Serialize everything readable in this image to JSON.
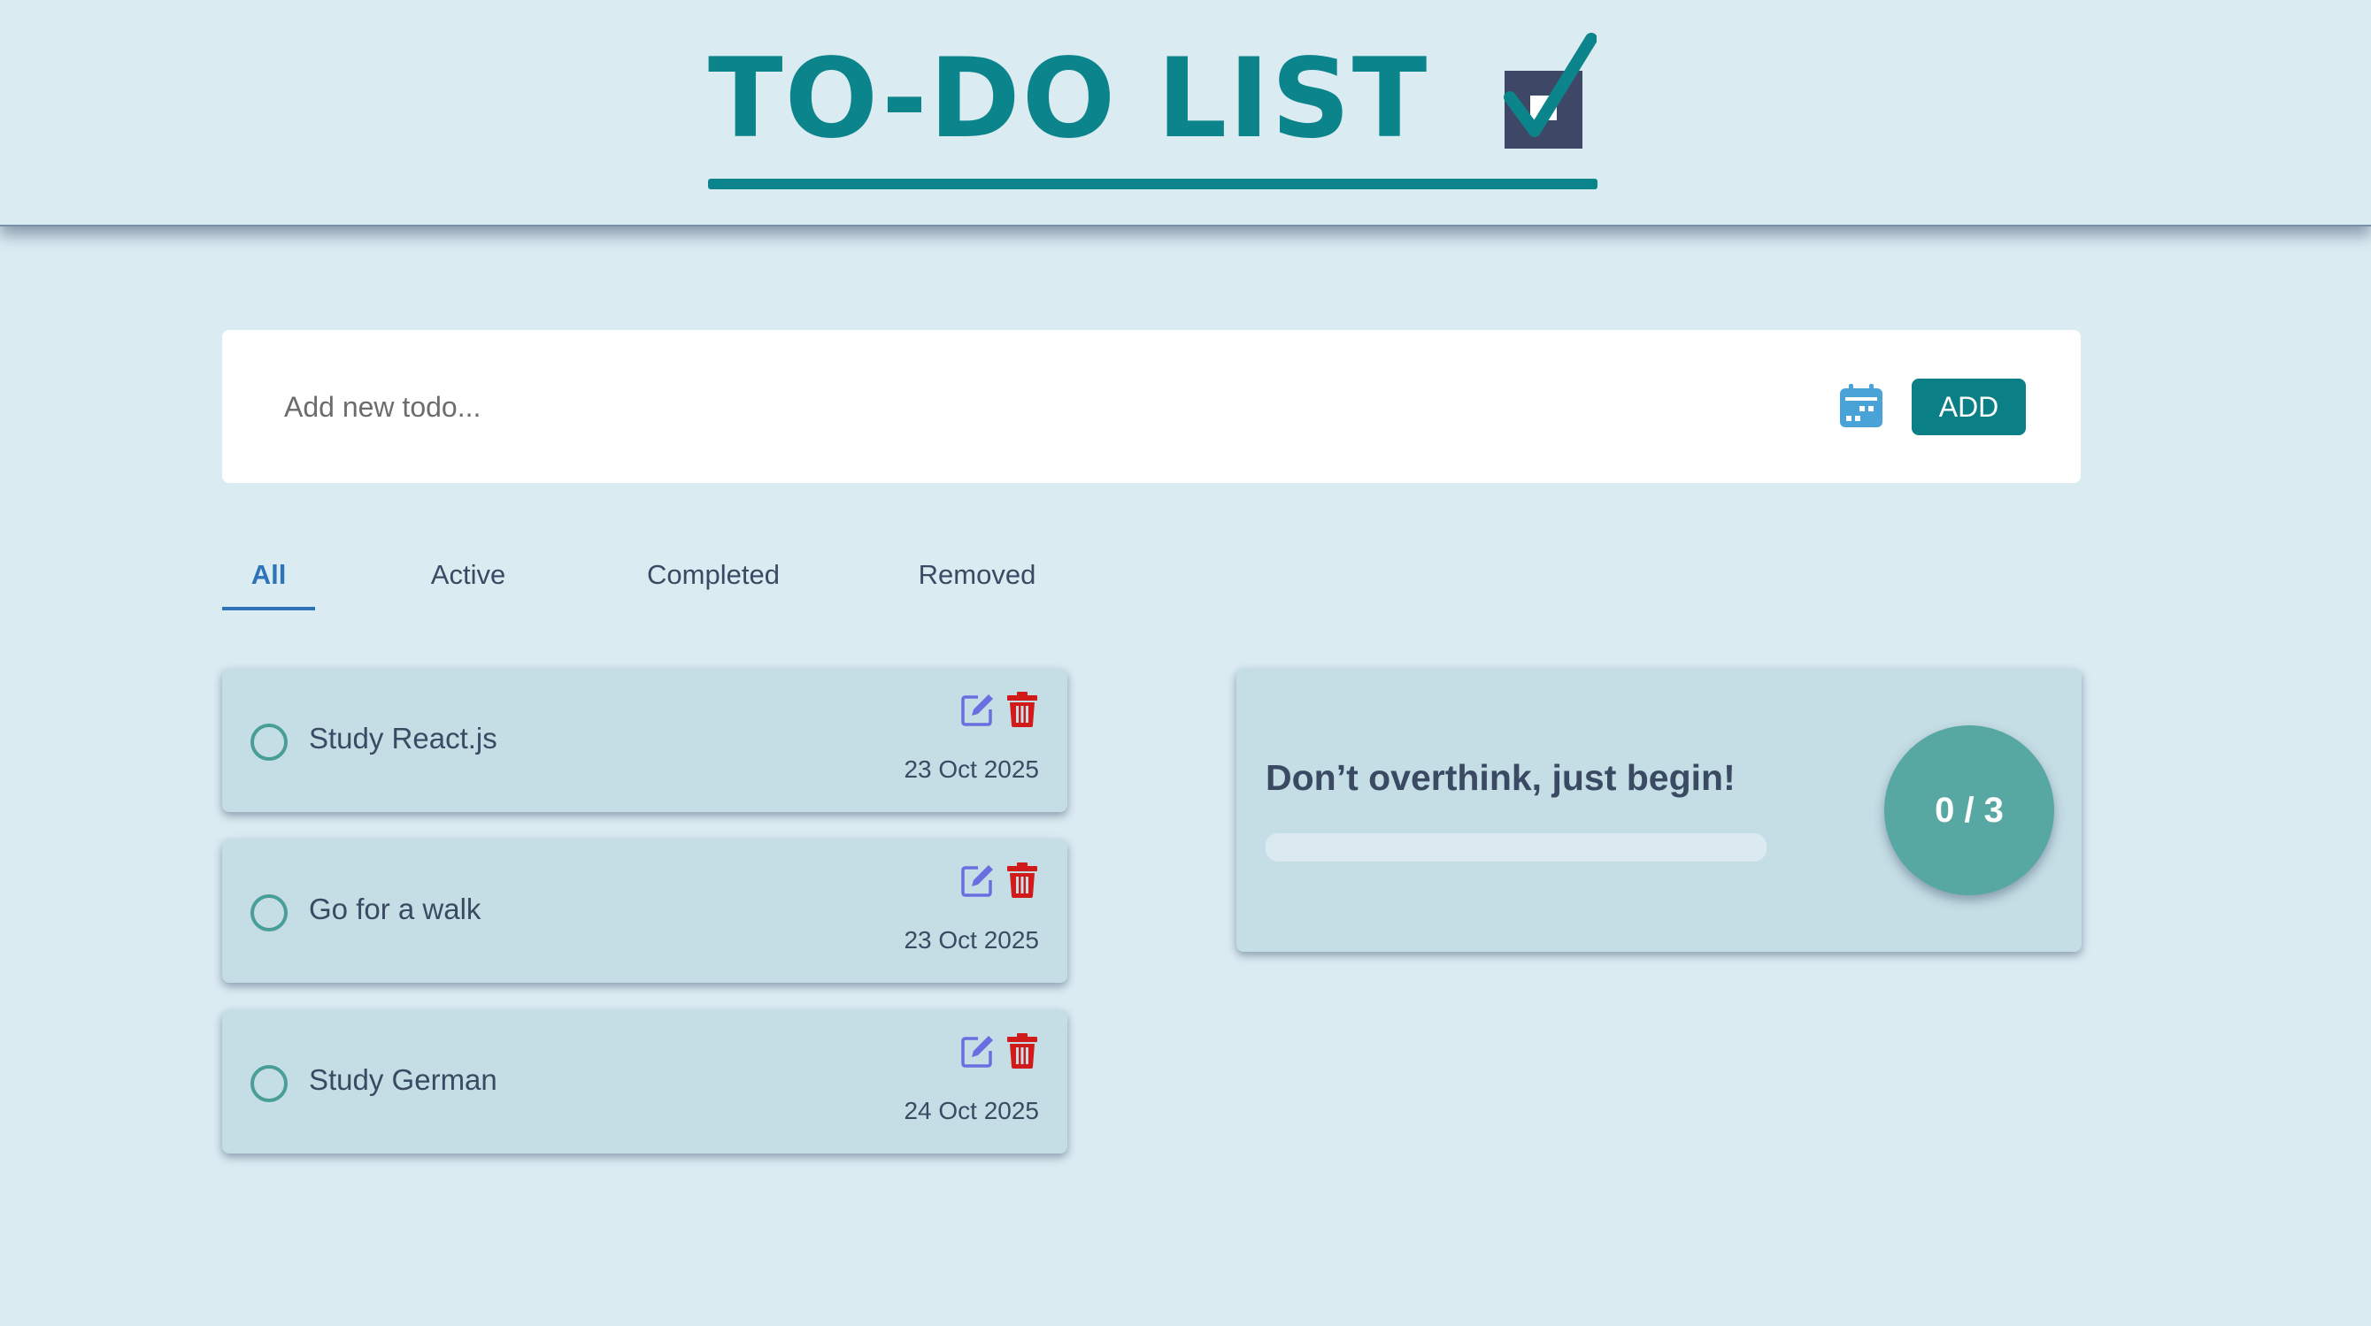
{
  "header": {
    "logo_text": "TO-DO LIST",
    "logo_icon": "checkbox-check-icon"
  },
  "add_form": {
    "placeholder": "Add new todo...",
    "value": "",
    "calendar_icon": "calendar-icon",
    "add_label": "ADD"
  },
  "tabs": [
    {
      "label": "All",
      "active": true
    },
    {
      "label": "Active",
      "active": false
    },
    {
      "label": "Completed",
      "active": false
    },
    {
      "label": "Removed",
      "active": false
    }
  ],
  "todos": [
    {
      "title": "Study React.js",
      "date": "23 Oct 2025",
      "completed": false
    },
    {
      "title": "Go for a walk",
      "date": "23 Oct 2025",
      "completed": false
    },
    {
      "title": "Study German",
      "date": "24 Oct 2025",
      "completed": false
    }
  ],
  "progress": {
    "message": "Don’t overthink, just begin!",
    "counter": "0 / 3",
    "completed": 0,
    "total": 3
  },
  "colors": {
    "background": "#dbebf2",
    "brand_teal": "#0b858b",
    "card": "#c5dee5",
    "active_tab": "#2d74b8",
    "edit_icon": "#6a6ee0",
    "delete_icon": "#d11a1a",
    "counter_circle": "#57a8a2",
    "calendar_icon": "#4aa3d8"
  }
}
